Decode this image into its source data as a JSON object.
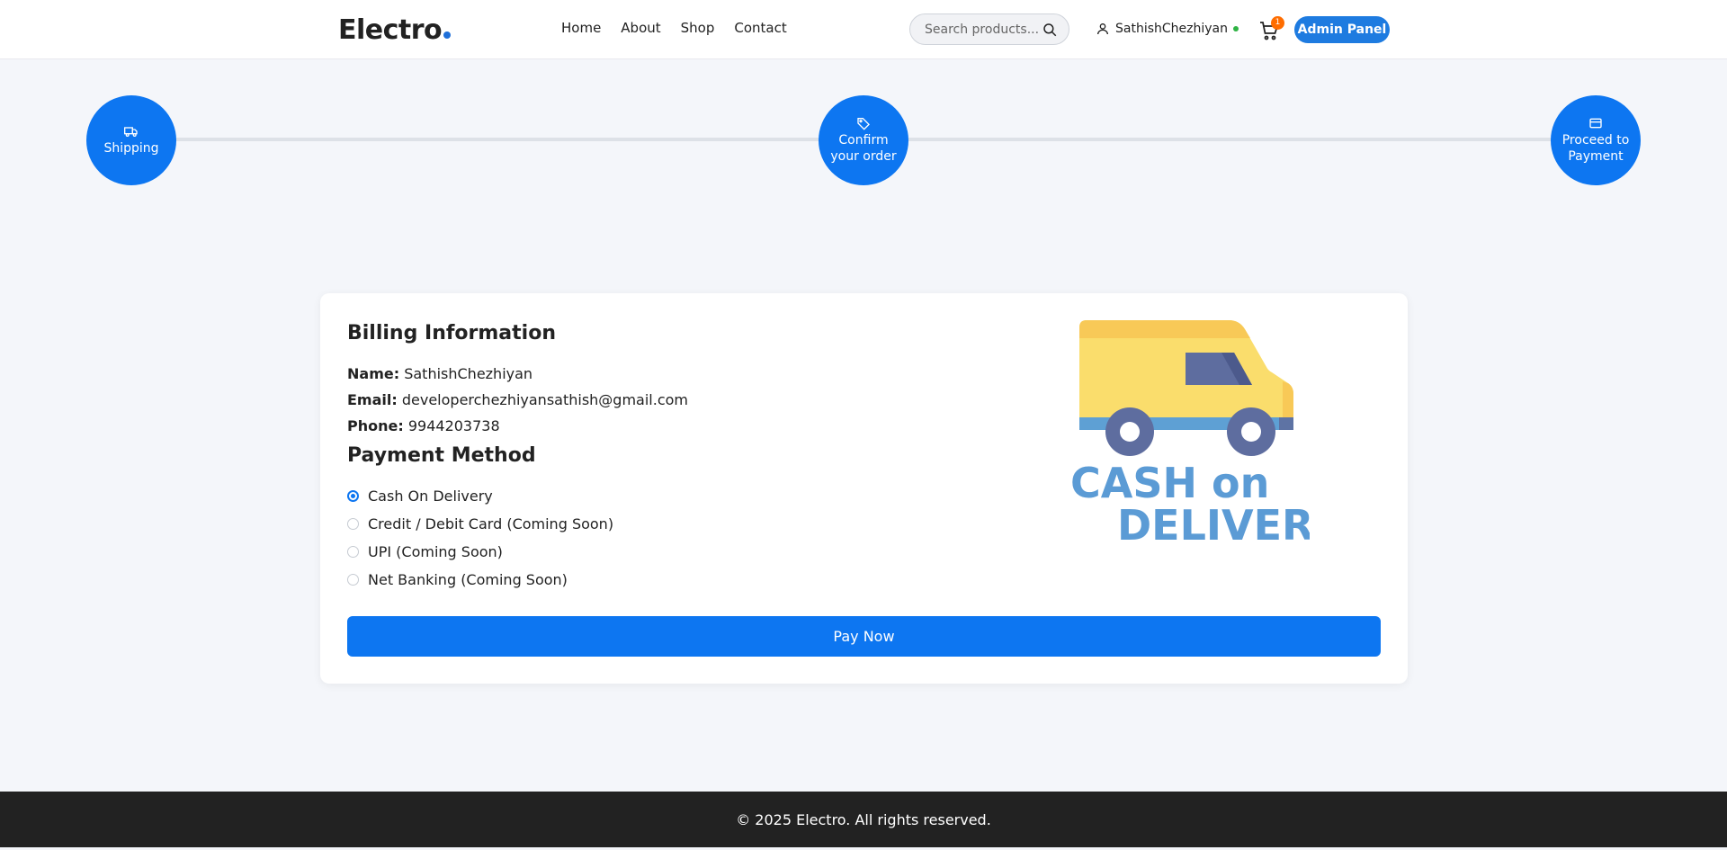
{
  "brand": {
    "logo_text": "Electro",
    "accent_color": "#1e6fd9"
  },
  "nav": {
    "items": [
      {
        "label": "Home"
      },
      {
        "label": "About"
      },
      {
        "label": "Shop"
      },
      {
        "label": "Contact"
      }
    ]
  },
  "search": {
    "placeholder": "Search products...",
    "icon": "search-icon"
  },
  "user": {
    "name": "SathishChezhiyan",
    "status_color": "#2fb344"
  },
  "cart": {
    "count": "1",
    "badge_color": "#ff6d00"
  },
  "admin": {
    "label": "Admin Panel"
  },
  "steps": [
    {
      "label_line1": "Shipping",
      "label_line2": "",
      "icon": "truck-icon"
    },
    {
      "label_line1": "Confirm",
      "label_line2": "your order",
      "icon": "tag-icon"
    },
    {
      "label_line1": "Proceed to",
      "label_line2": "Payment",
      "icon": "card-icon"
    }
  ],
  "billing": {
    "title": "Billing Information",
    "name_label": "Name:",
    "name_value": "SathishChezhiyan",
    "email_label": "Email:",
    "email_value": "developerchezhiyansathish@gmail.com",
    "phone_label": "Phone:",
    "phone_value": "9944203738"
  },
  "payment": {
    "title": "Payment Method",
    "options": [
      {
        "label": "Cash On Delivery",
        "selected": true
      },
      {
        "label": "Credit / Debit Card (Coming Soon)",
        "selected": false
      },
      {
        "label": "UPI (Coming Soon)",
        "selected": false
      },
      {
        "label": "Net Banking (Coming Soon)",
        "selected": false
      }
    ],
    "pay_button": "Pay Now",
    "art_text_line1": "CASH on",
    "art_text_line2": "DELIVERY"
  },
  "footer": {
    "text": "© 2025 Electro. All rights reserved."
  },
  "colors": {
    "primary": "#0d76f1",
    "footer_bg": "#222222"
  }
}
